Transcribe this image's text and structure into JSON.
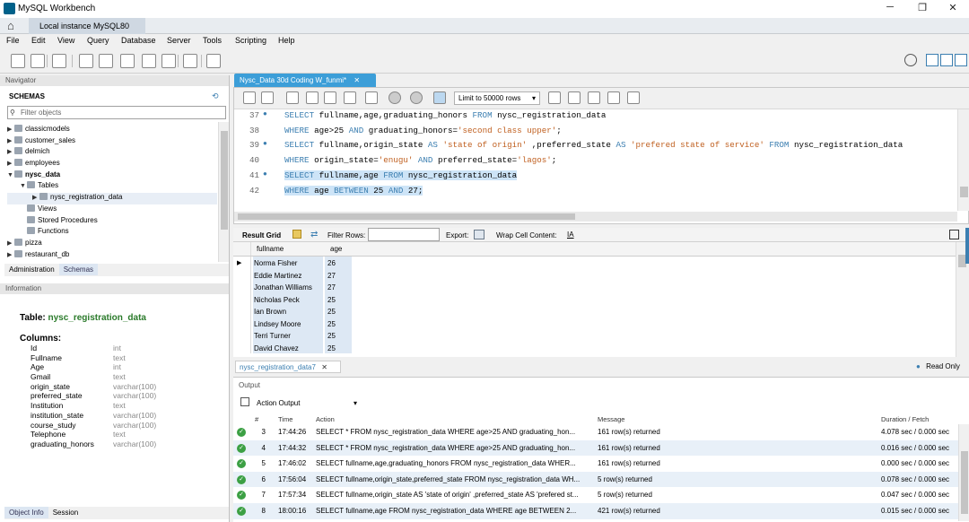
{
  "window": {
    "title": "MySQL Workbench",
    "connection_tab": "Local instance MySQL80",
    "home_icon": "home-icon"
  },
  "menu": [
    "File",
    "Edit",
    "View",
    "Query",
    "Database",
    "Server",
    "Tools",
    "Scripting",
    "Help"
  ],
  "navigator": {
    "header": "Navigator",
    "schemas_label": "SCHEMAS",
    "filter_placeholder": "Filter objects",
    "tree": [
      {
        "label": "classicmodels",
        "level": 0,
        "arrow": "▶",
        "bold": false
      },
      {
        "label": "customer_sales",
        "level": 0,
        "arrow": "▶",
        "bold": false
      },
      {
        "label": "delmich",
        "level": 0,
        "arrow": "▶",
        "bold": false
      },
      {
        "label": "employees",
        "level": 0,
        "arrow": "▶",
        "bold": false
      },
      {
        "label": "nysc_data",
        "level": 0,
        "arrow": "▼",
        "bold": true
      },
      {
        "label": "Tables",
        "level": 1,
        "arrow": "▼",
        "bold": false
      },
      {
        "label": "nysc_registration_data",
        "level": 2,
        "arrow": "▶",
        "bold": false
      },
      {
        "label": "Views",
        "level": 1,
        "arrow": "",
        "bold": false
      },
      {
        "label": "Stored Procedures",
        "level": 1,
        "arrow": "",
        "bold": false
      },
      {
        "label": "Functions",
        "level": 1,
        "arrow": "",
        "bold": false
      },
      {
        "label": "pizza",
        "level": 0,
        "arrow": "▶",
        "bold": false
      },
      {
        "label": "restaurant_db",
        "level": 0,
        "arrow": "▶",
        "bold": false
      }
    ],
    "bottom_tabs": [
      "Administration",
      "Schemas"
    ]
  },
  "information": {
    "header": "Information",
    "table_prefix": "Table:",
    "table_name": "nysc_registration_data",
    "columns_label": "Columns:",
    "columns": [
      {
        "name": "Id",
        "type": "int"
      },
      {
        "name": "Fullname",
        "type": "text"
      },
      {
        "name": "Age",
        "type": "int"
      },
      {
        "name": "Gmail",
        "type": "text"
      },
      {
        "name": "origin_state",
        "type": "varchar(100)"
      },
      {
        "name": "preferred_state",
        "type": "varchar(100)"
      },
      {
        "name": "Institution",
        "type": "text"
      },
      {
        "name": "institution_state",
        "type": "varchar(100)"
      },
      {
        "name": "course_study",
        "type": "varchar(100)"
      },
      {
        "name": "Telephone",
        "type": "text"
      },
      {
        "name": "graduating_honors",
        "type": "varchar(100)"
      }
    ],
    "bottom_tabs": [
      "Object Info",
      "Session"
    ]
  },
  "editor": {
    "tab_label": "Nysc_Data 30d Coding W_funmi*",
    "limit_label": "Limit to 50000 rows",
    "lines": [
      {
        "num": "37",
        "dot": "●",
        "segments": [
          [
            "kw",
            "SELECT"
          ],
          [
            "t",
            " fullname,age,graduating_honors "
          ],
          [
            "kw",
            "FROM"
          ],
          [
            "t",
            " nysc_registration_data"
          ]
        ],
        "sel": false
      },
      {
        "num": "38",
        "dot": "",
        "segments": [
          [
            "kw",
            "WHERE"
          ],
          [
            "t",
            " age>25 "
          ],
          [
            "kw",
            "AND"
          ],
          [
            "t",
            " graduating_honors="
          ],
          [
            "str",
            "'second class upper'"
          ],
          [
            "t",
            ";"
          ]
        ],
        "sel": false
      },
      {
        "num": "39",
        "dot": "●",
        "segments": [
          [
            "kw",
            "SELECT"
          ],
          [
            "t",
            " fullname,origin_state "
          ],
          [
            "kw",
            "AS"
          ],
          [
            "t",
            " "
          ],
          [
            "str",
            "'state of origin'"
          ],
          [
            "t",
            " ,preferred_state "
          ],
          [
            "kw",
            "AS"
          ],
          [
            "t",
            " "
          ],
          [
            "str",
            "'prefered state of service'"
          ],
          [
            "t",
            " "
          ],
          [
            "kw",
            "FROM"
          ],
          [
            "t",
            " nysc_registration_data"
          ]
        ],
        "sel": false
      },
      {
        "num": "40",
        "dot": "",
        "segments": [
          [
            "kw",
            "WHERE"
          ],
          [
            "t",
            " origin_state="
          ],
          [
            "str",
            "'enugu'"
          ],
          [
            "t",
            " "
          ],
          [
            "kw",
            "AND"
          ],
          [
            "t",
            " preferred_state="
          ],
          [
            "str",
            "'lagos'"
          ],
          [
            "t",
            ";"
          ]
        ],
        "sel": false
      },
      {
        "num": "41",
        "dot": "●",
        "segments": [
          [
            "kw",
            "SELECT"
          ],
          [
            "t",
            " fullname,age "
          ],
          [
            "kw",
            "FROM"
          ],
          [
            "t",
            " nysc_registration_data"
          ]
        ],
        "sel": true
      },
      {
        "num": "42",
        "dot": "",
        "segments": [
          [
            "kw",
            "WHERE"
          ],
          [
            "t",
            " age "
          ],
          [
            "kw",
            "BETWEEN"
          ],
          [
            "t",
            " 25 "
          ],
          [
            "kw",
            "AND"
          ],
          [
            "t",
            " 27;"
          ]
        ],
        "sel": true
      }
    ]
  },
  "result": {
    "grid_label": "Result Grid",
    "filter_label": "Filter Rows:",
    "export_label": "Export:",
    "wrap_label": "Wrap Cell Content:",
    "columns": [
      "fullname",
      "age"
    ],
    "rows": [
      [
        "Norma Fisher",
        "26"
      ],
      [
        "Eddie Martinez",
        "27"
      ],
      [
        "Jonathan Williams",
        "27"
      ],
      [
        "Nicholas Peck",
        "25"
      ],
      [
        "Ian Brown",
        "25"
      ],
      [
        "Lindsey Moore",
        "25"
      ],
      [
        "Terri Turner",
        "25"
      ],
      [
        "David Chavez",
        "25"
      ]
    ],
    "tab_label": "nysc_registration_data7",
    "read_only": "Read Only"
  },
  "output": {
    "header": "Output",
    "selector": "Action Output",
    "columns": {
      "num": "#",
      "time": "Time",
      "action": "Action",
      "message": "Message",
      "duration": "Duration / Fetch"
    },
    "rows": [
      {
        "num": "3",
        "time": "17:44:26",
        "action": "SELECT * FROM nysc_registration_data WHERE age>25 AND graduating_hon...",
        "message": "161 row(s) returned",
        "duration": "4.078 sec / 0.000 sec"
      },
      {
        "num": "4",
        "time": "17:44:32",
        "action": "SELECT * FROM nysc_registration_data WHERE age>25 AND graduating_hon...",
        "message": "161 row(s) returned",
        "duration": "0.016 sec / 0.000 sec"
      },
      {
        "num": "5",
        "time": "17:46:02",
        "action": "SELECT fullname,age,graduating_honors FROM nysc_registration_data WHER...",
        "message": "161 row(s) returned",
        "duration": "0.000 sec / 0.000 sec"
      },
      {
        "num": "6",
        "time": "17:56:04",
        "action": "SELECT fullname,origin_state,preferred_state FROM nysc_registration_data WH...",
        "message": "5 row(s) returned",
        "duration": "0.078 sec / 0.000 sec"
      },
      {
        "num": "7",
        "time": "17:57:34",
        "action": "SELECT fullname,origin_state AS 'state of origin' ,preferred_state AS 'prefered st...",
        "message": "5 row(s) returned",
        "duration": "0.047 sec / 0.000 sec"
      },
      {
        "num": "8",
        "time": "18:00:16",
        "action": "SELECT fullname,age FROM nysc_registration_data WHERE age BETWEEN 2...",
        "message": "421 row(s) returned",
        "duration": "0.015 sec / 0.000 sec"
      }
    ]
  }
}
